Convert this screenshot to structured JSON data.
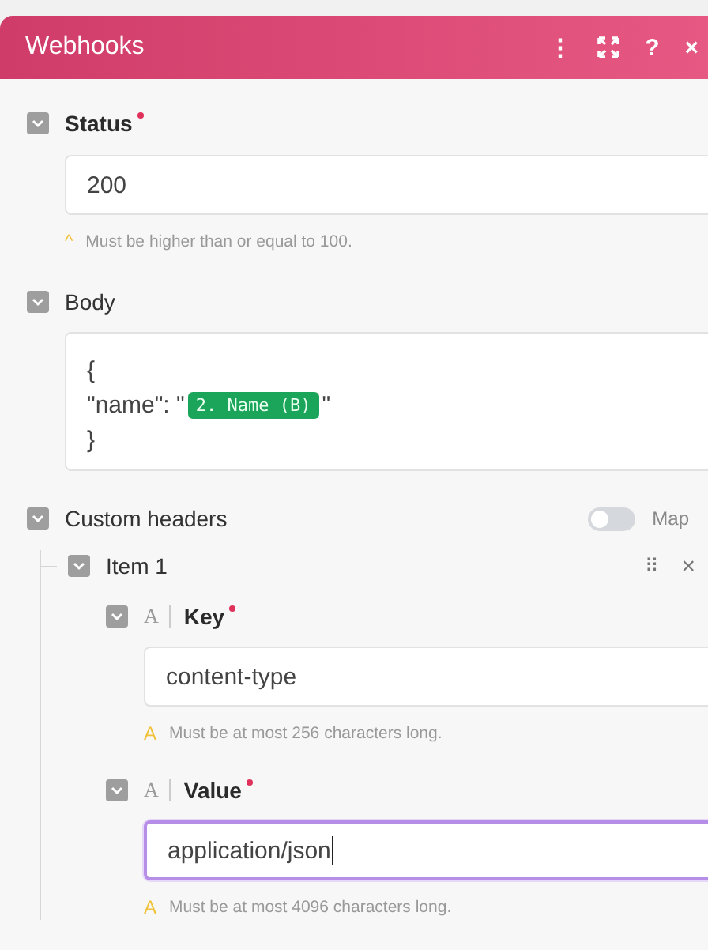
{
  "window": {
    "title": "Webhooks",
    "menu_icon": "⋮",
    "help_icon": "?",
    "close_icon": "×"
  },
  "status": {
    "label": "Status",
    "required": true,
    "expanded": true,
    "value": "200",
    "hint_mark": "^",
    "hint": "Must be higher than or equal to 100."
  },
  "body": {
    "label": "Body",
    "expanded": true,
    "lines": [
      {
        "text": "{"
      },
      {
        "text": "\"name\": \"",
        "chip": "2. Name (B)",
        "after": "\""
      },
      {
        "text": "}"
      }
    ]
  },
  "custom_headers": {
    "label": "Custom headers",
    "expanded": true,
    "map_on": false,
    "map_label": "Map",
    "items": [
      {
        "label": "Item 1",
        "expanded": true,
        "drag_icon": "⠿",
        "remove_icon": "×",
        "fields": [
          {
            "type_mark": "A",
            "label": "Key",
            "required": true,
            "expanded": true,
            "value": "content-type",
            "focused": false,
            "hint_mark": "A",
            "hint": "Must be at most 256 characters long."
          },
          {
            "type_mark": "A",
            "label": "Value",
            "required": true,
            "expanded": true,
            "value": "application/json",
            "focused": true,
            "hint_mark": "A",
            "hint": "Must be at most 4096 characters long."
          }
        ]
      }
    ]
  }
}
